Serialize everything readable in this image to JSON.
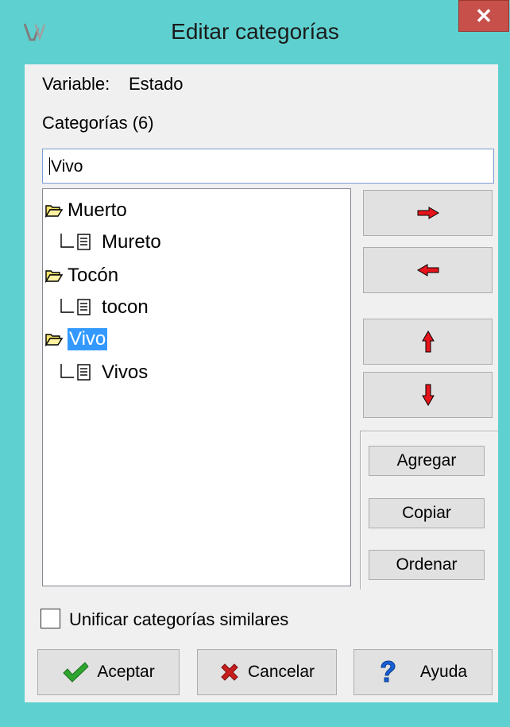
{
  "window": {
    "title": "Editar categorías",
    "close_label": "✕"
  },
  "variable": {
    "label": "Variable:",
    "value": "Estado"
  },
  "categories": {
    "heading": "Categorías (6)",
    "edit_value": "Vivo"
  },
  "tree": {
    "items": [
      {
        "label": "Muerto",
        "child": "Mureto"
      },
      {
        "label": "Tocón",
        "child": "tocon"
      },
      {
        "label": "Vivo",
        "child": "Vivos",
        "selected": true
      }
    ]
  },
  "side_buttons": {
    "add": "Agregar",
    "copy": "Copiar",
    "sort": "Ordenar"
  },
  "options": {
    "unify_label": "Unificar categorías similares",
    "unify_checked": false
  },
  "footer": {
    "accept": "Aceptar",
    "cancel": "Cancelar",
    "help": "Ayuda"
  },
  "colors": {
    "frame": "#5fd0d0",
    "close": "#c7504a",
    "selection": "#3399ff",
    "arrow": "#e8141b"
  }
}
